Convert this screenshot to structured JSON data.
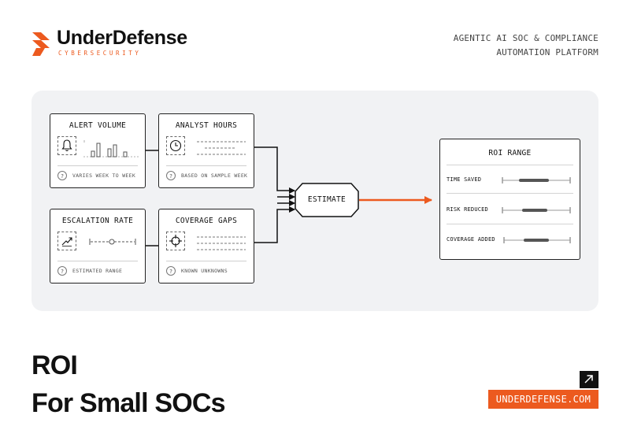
{
  "brand": {
    "name": "UnderDefense",
    "sub": "CYBERSECURITY",
    "accent": "#ec5a1f"
  },
  "tagline": {
    "line1": "AGENTIC AI SOC & COMPLIANCE",
    "line2": "AUTOMATION PLATFORM"
  },
  "diagram": {
    "inputs": [
      {
        "title": "ALERT VOLUME",
        "note": "VARIES WEEK TO WEEK",
        "icon": "bell-icon"
      },
      {
        "title": "ANALYST HOURS",
        "note": "BASED ON SAMPLE WEEK",
        "icon": "clock-icon"
      },
      {
        "title": "ESCALATION RATE",
        "note": "ESTIMATED RANGE",
        "icon": "trend-up-icon"
      },
      {
        "title": "COVERAGE GAPS",
        "note": "KNOWN UNKNOWNS",
        "icon": "crosshair-icon"
      }
    ],
    "help_glyph": "?",
    "estimate": "ESTIMATE",
    "roi": {
      "title": "ROI RANGE",
      "rows": [
        {
          "label": "TIME SAVED"
        },
        {
          "label": "RISK REDUCED"
        },
        {
          "label": "COVERAGE ADDED"
        }
      ]
    }
  },
  "headline": {
    "line1": "ROI",
    "line2": "For Small SOCs"
  },
  "footer": {
    "link_icon": "arrow-up-right-icon",
    "url": "UNDERDEFENSE.COM"
  }
}
